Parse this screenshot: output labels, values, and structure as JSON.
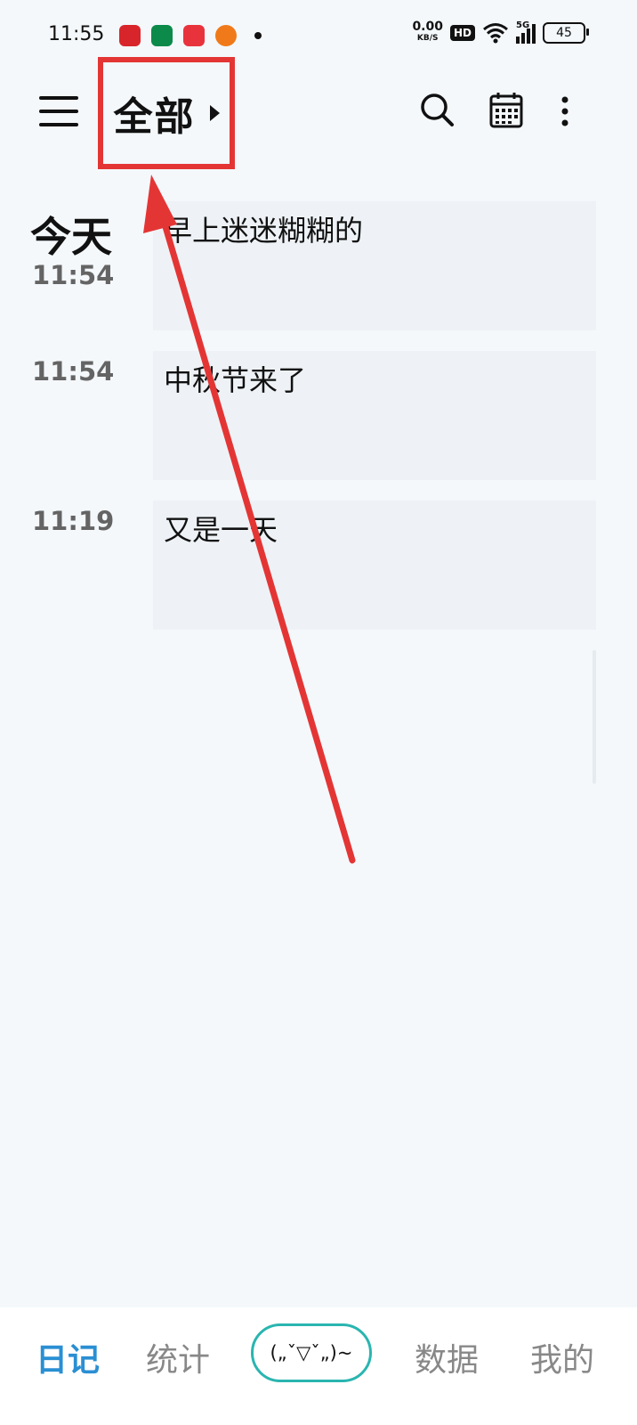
{
  "status_bar": {
    "time": "11:55",
    "net_speed": "0.00",
    "net_unit": "KB/S",
    "hd": "HD",
    "network": "5G",
    "battery": "45"
  },
  "topbar": {
    "category": "全部"
  },
  "timeline": {
    "day_label": "今天",
    "entries": [
      {
        "time": "11:54",
        "text": "早上迷迷糊糊的"
      },
      {
        "time": "11:54",
        "text": "中秋节来了"
      },
      {
        "time": "11:19",
        "text": "又是一天"
      }
    ]
  },
  "bottom_nav": {
    "diary": "日记",
    "stats": "统计",
    "mood": "(„ˇ▽ˇ„)~",
    "data": "数据",
    "mine": "我的"
  },
  "colors": {
    "accent": "#2a8fd3",
    "mood_border": "#2ab5b0",
    "annotation_red": "#e43535",
    "card_bg": "#eef2f6",
    "page_bg": "#f4f8fb"
  }
}
